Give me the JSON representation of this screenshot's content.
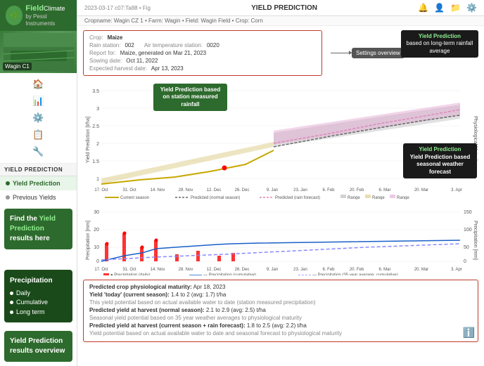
{
  "app": {
    "title": "FieldClimate",
    "subtitle": "by Pessl Instruments",
    "timestamp": "2023-03-17 c07:Ta88 • Fig"
  },
  "topbar": {
    "section_title": "YIELD PREDICTION",
    "icons": [
      "🔔",
      "👤",
      "📁",
      "⚙️"
    ]
  },
  "breadcrumb": {
    "text": "Cropname: Wagin CZ 1 • Farm: Wagin • Field: Wagin Field • Crop: Corn"
  },
  "sidebar": {
    "map_label": "Wagin C1",
    "section_title": "YIELD PREDICTION",
    "menu": [
      {
        "label": "Yield Prediction",
        "active": true
      },
      {
        "label": "Previous Yields",
        "active": false
      }
    ],
    "callout1": {
      "text": "Find the Yield Prediction results here"
    },
    "callout2": {
      "title": "Precipitation",
      "bullets": [
        "Daily",
        "Cumulative",
        "Long term"
      ]
    },
    "callout3": {
      "text": "Yield Prediction results overview"
    }
  },
  "settings": {
    "label": "Settings overview",
    "crop": "Maize",
    "rain_station": "002",
    "air_temp_station": "0020",
    "report_for": "Maize, generated on Mar 21, 2023",
    "sowing_date": "Oct 11, 2022",
    "expected_harvest_date": "Apr 13, 2023"
  },
  "annotations": {
    "station_rainfall": "Yield Prediction based on station measured rainfall",
    "long_term": "Yield Prediction based on long-term rainfall average",
    "seasonal_forecast": "Yield Prediction based seasonal weather forecast"
  },
  "chart1": {
    "y_label": "Yield Prediction [t/ha]",
    "y_right_label": "Physiological Maturity",
    "x_labels": [
      "17. Oct",
      "31. Oct",
      "14. Nov",
      "28. Nov",
      "12. Dec",
      "26. Dec",
      "9. Jan",
      "23. Jan",
      "6. Feb",
      "20. Feb",
      "6. Mar",
      "20. Mar",
      "3. Apr"
    ],
    "legend": [
      "Current season",
      "Predicted (normal season)",
      "Predicted (rain forecast)",
      "Range",
      "Range",
      "Range"
    ]
  },
  "chart2": {
    "y_label": "Precipitation [mm]",
    "y_right_label": "Precipitation [mm]",
    "x_labels": [
      "17. Oct",
      "31. Oct",
      "14. Nov",
      "28. Nov",
      "12. Dec",
      "26. Dec",
      "9. Jan",
      "23. Jan",
      "6. Feb",
      "20. Feb",
      "6. Mar",
      "20. Mar",
      "3. Apr"
    ],
    "legend": [
      "Precipitation (daily)",
      "Precipitation (cumulative)",
      "Precipitation (35 year average, cumulative)"
    ]
  },
  "results": {
    "maturity": "Apr 18, 2023",
    "yield_today_range": "1.4 to 2 (avg: 1.7)  t/ha",
    "yield_today_desc": "This yield potential based on actual available water to date (station measured precipitation)",
    "yield_harvest_normal_range": "2.1 to 2.9 (avg: 2.5)  t/ha",
    "yield_harvest_normal_desc": "Seasonal yield potential based on 35 year weather averages to physiological maturity",
    "yield_harvest_forecast_range": "1.8 to 2.5 (avg: 2.2)  t/ha",
    "yield_harvest_forecast_desc": "Yield potential based on actual available water to date and seasonal forecast to physiological maturity"
  }
}
